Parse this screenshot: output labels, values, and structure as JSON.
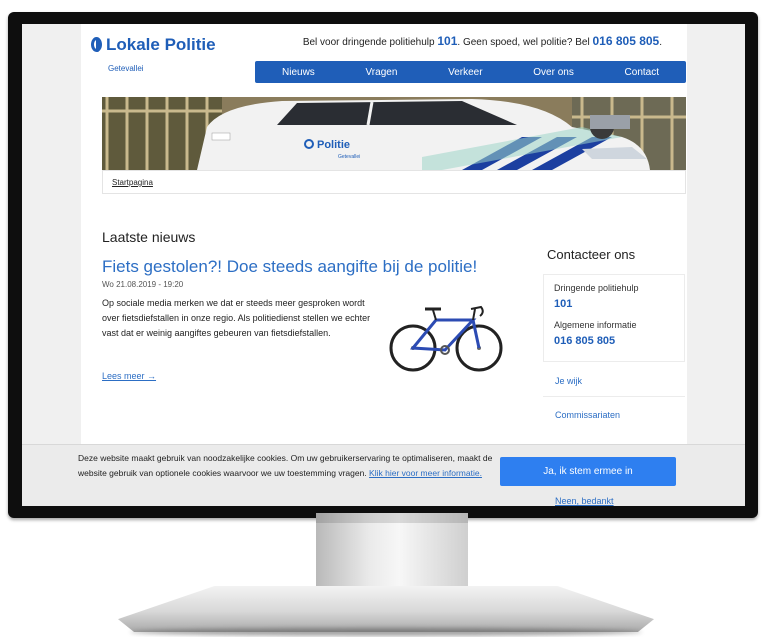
{
  "header": {
    "logo_text": "Lokale Politie",
    "logo_sub": "Getevallei",
    "urgent_prefix": "Bel voor dringende politiehulp ",
    "urgent_number": "101",
    "urgent_middle": ". Geen spoed, wel politie? Bel ",
    "urgent_number2": "016 805 805",
    "urgent_suffix": "."
  },
  "nav": {
    "items": [
      "Nieuws",
      "Vragen",
      "Verkeer",
      "Over ons",
      "Contact"
    ]
  },
  "hero": {
    "car_text": "Politie",
    "car_subtext": "Getevallei"
  },
  "breadcrumb": "Startpagina",
  "main": {
    "section_title": "Laatste nieuws",
    "article": {
      "title": "Fiets gestolen?! Doe steeds aangifte bij de politie!",
      "date": "Wo 21.08.2019 - 19:20",
      "body": "Op sociale media merken we dat er steeds meer gesproken wordt over fietsdiefstallen in onze regio. Als politiedienst stellen we echter vast dat er weinig aangiftes gebeuren van fietsdiefstallen.",
      "read_more": "Lees meer →"
    }
  },
  "sidebar": {
    "title": "Contacteer ons",
    "urgent_label": "Dringende politiehulp",
    "urgent_number": "101",
    "info_label": "Algemene informatie",
    "info_number": "016 805 805",
    "links": [
      "Je wijk",
      "Commissariaten"
    ]
  },
  "cookie": {
    "text": "Deze website maakt gebruik van noodzakelijke cookies. Om uw gebruikerservaring te optimaliseren, maakt de website gebruik van optionele cookies waarvoor we uw toestemming vragen. ",
    "link": "Klik hier voor meer informatie.",
    "accept": "Ja, ik stem ermee in",
    "decline": "Neen, bedankt"
  },
  "colors": {
    "brand": "#1f5eb8",
    "link": "#2c6ec4",
    "accept_button": "#2e7ff0"
  }
}
